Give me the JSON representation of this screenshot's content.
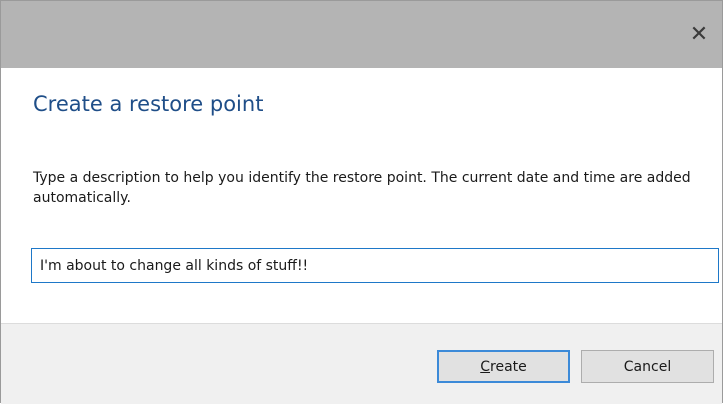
{
  "window": {
    "close_glyph": "✕",
    "close_icon": "close-icon"
  },
  "dialog": {
    "heading": "Create a restore point",
    "description": "Type a description to help you identify the restore point. The current date and time are added automatically.",
    "input_value": "I'm about to change all kinds of stuff!!"
  },
  "buttons": {
    "create_mnemonic": "C",
    "create_rest": "reate",
    "cancel_label": "Cancel"
  },
  "colors": {
    "titlebar": "#b4b4b4",
    "heading": "#1f4e88",
    "accent_border": "#3c8ad8",
    "footer": "#f0f0f0"
  }
}
